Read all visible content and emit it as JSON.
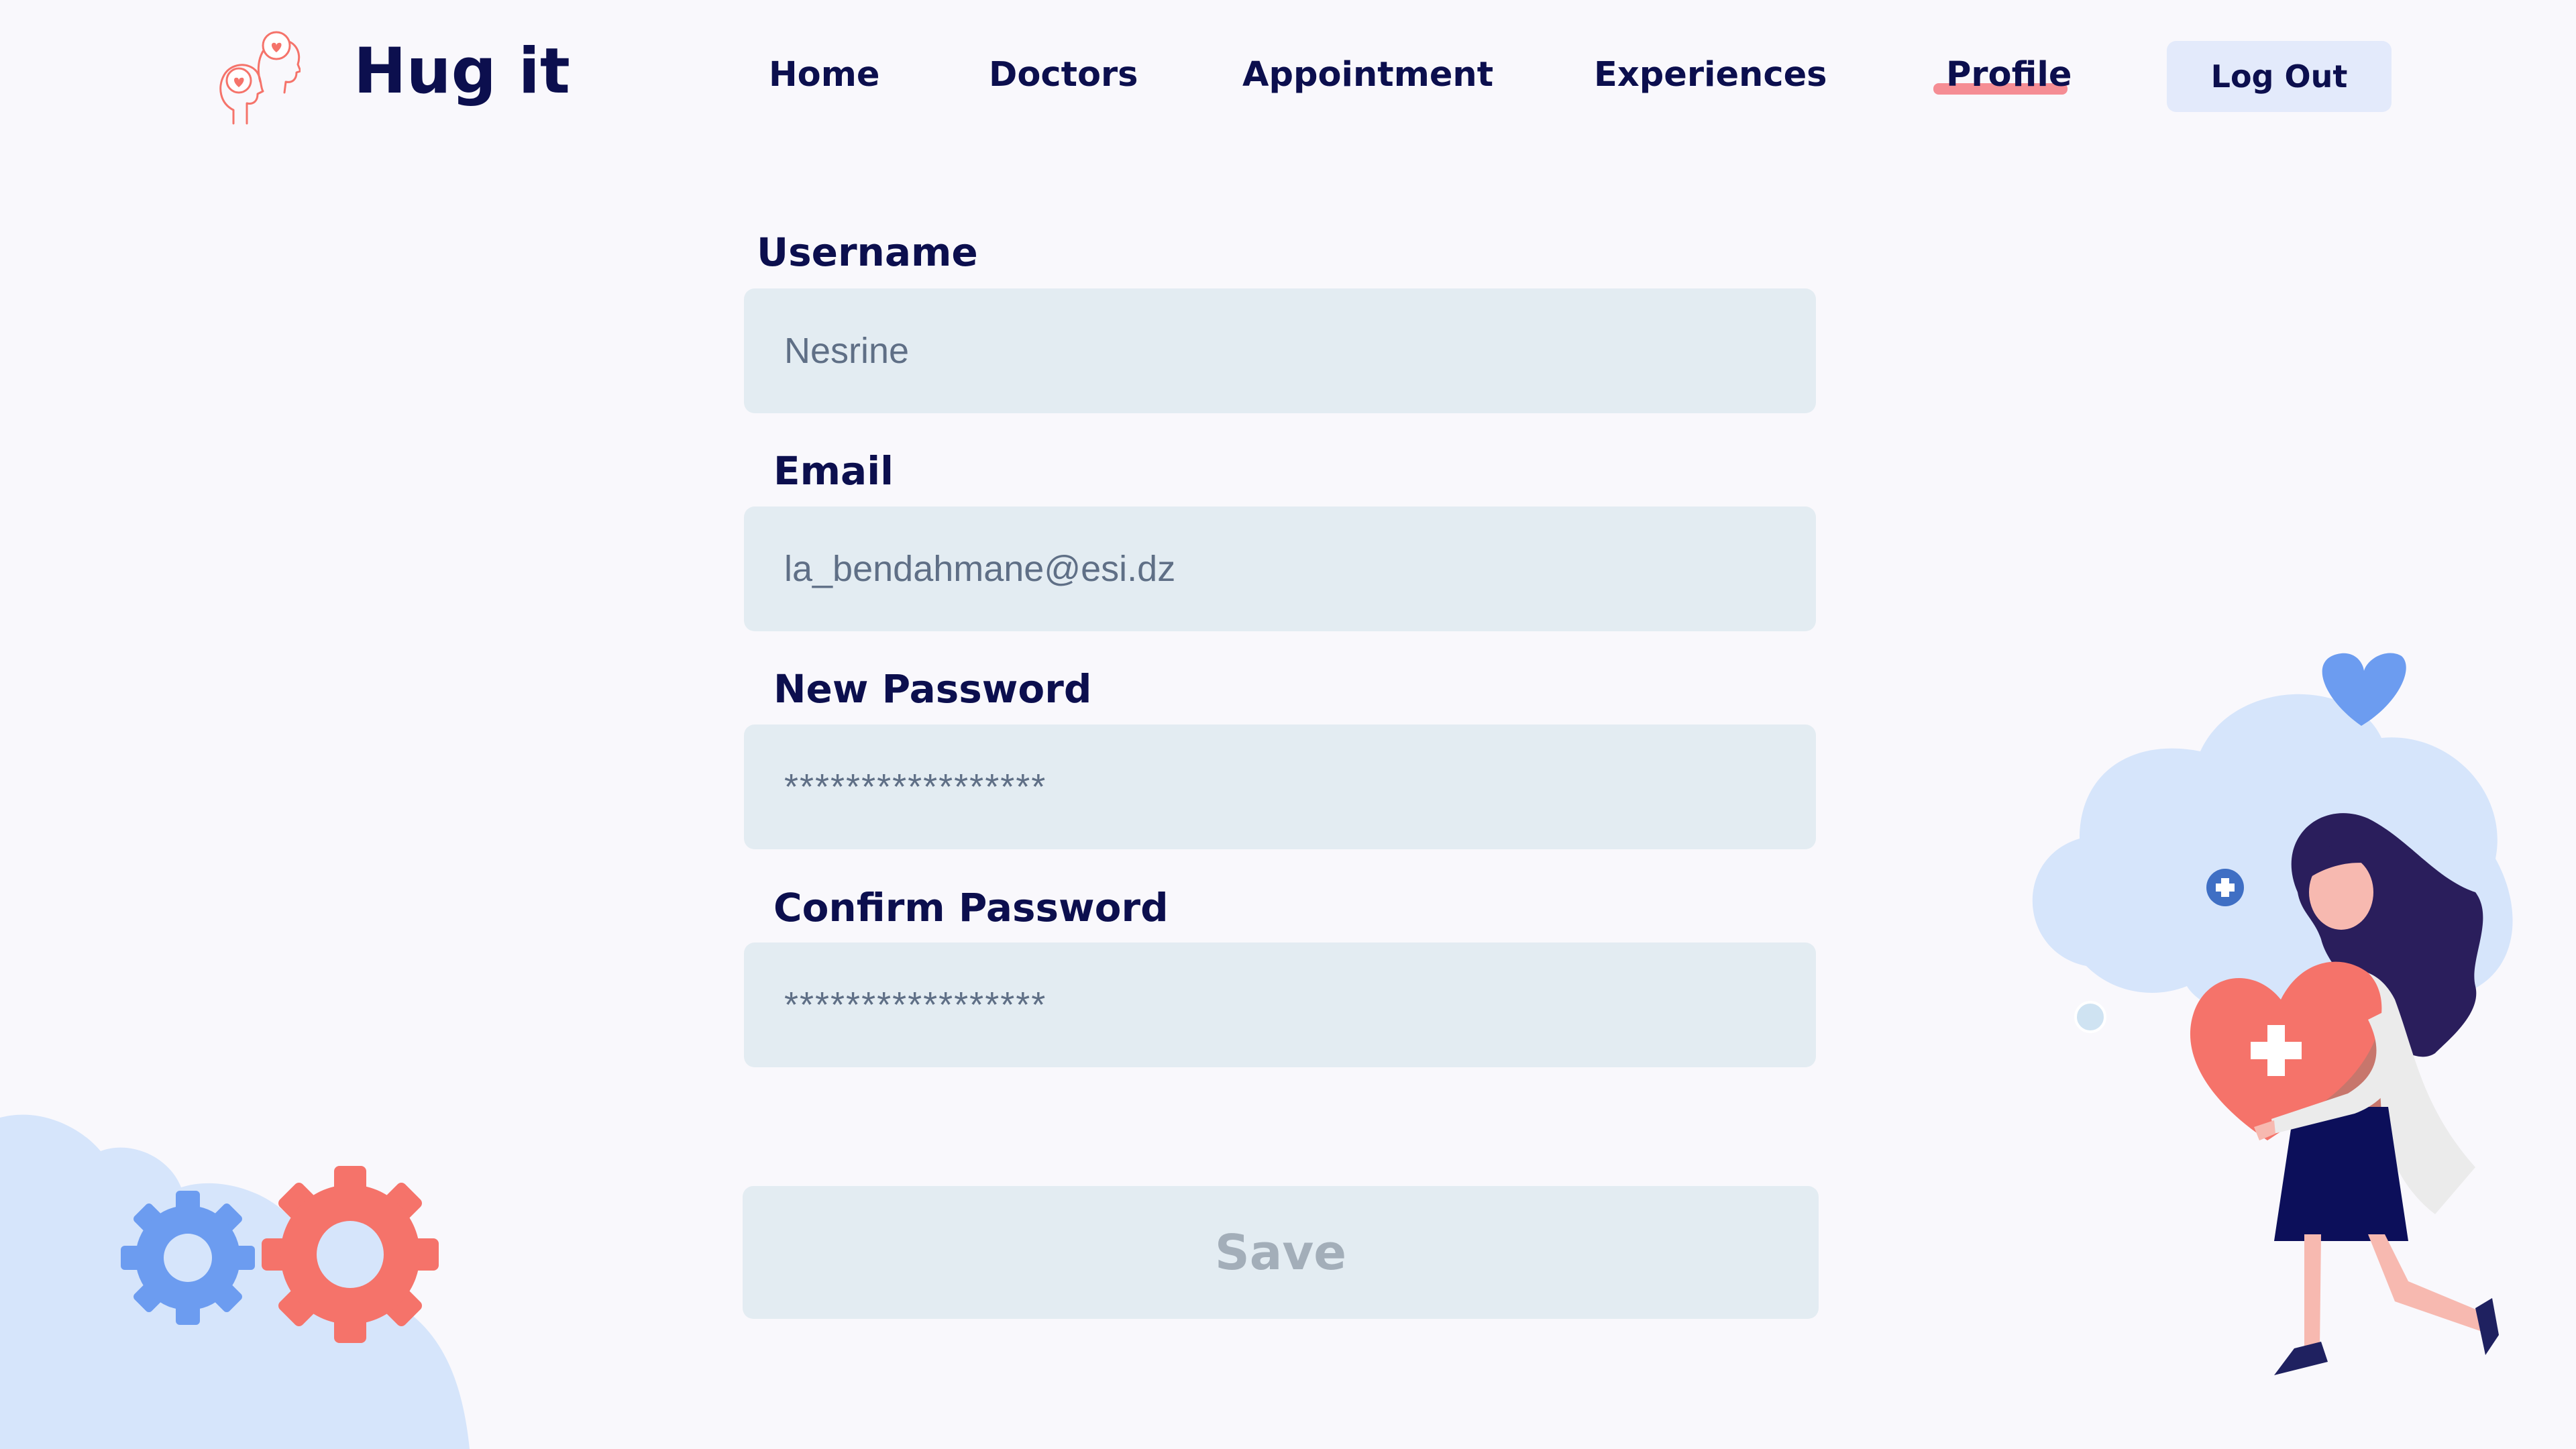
{
  "app": {
    "brand": "Hug it",
    "logo_icon": "heads-with-hearts-icon"
  },
  "nav": {
    "items": [
      {
        "label": "Home"
      },
      {
        "label": "Doctors"
      },
      {
        "label": "Appointment"
      },
      {
        "label": "Experiences"
      },
      {
        "label": "Profile",
        "active": true
      }
    ],
    "logout_label": "Log Out"
  },
  "form": {
    "username": {
      "label": "Username",
      "value": "Nesrine"
    },
    "email": {
      "label": "Email",
      "value": "la_bendahmane@esi.dz"
    },
    "new_password": {
      "label": "New Password",
      "value": "*****************"
    },
    "confirm_password": {
      "label": "Confirm Password",
      "value": "*****************"
    },
    "save_label": "Save"
  },
  "colors": {
    "background": "#f9f8fc",
    "text_primary": "#0c0f4e",
    "input_bg": "#e3ecf2",
    "active_underline": "#f58d94",
    "logout_bg": "#e3eafb",
    "save_text": "#a3aeb9",
    "accent_coral": "#f5736a",
    "accent_blue": "#6c9cf0"
  }
}
